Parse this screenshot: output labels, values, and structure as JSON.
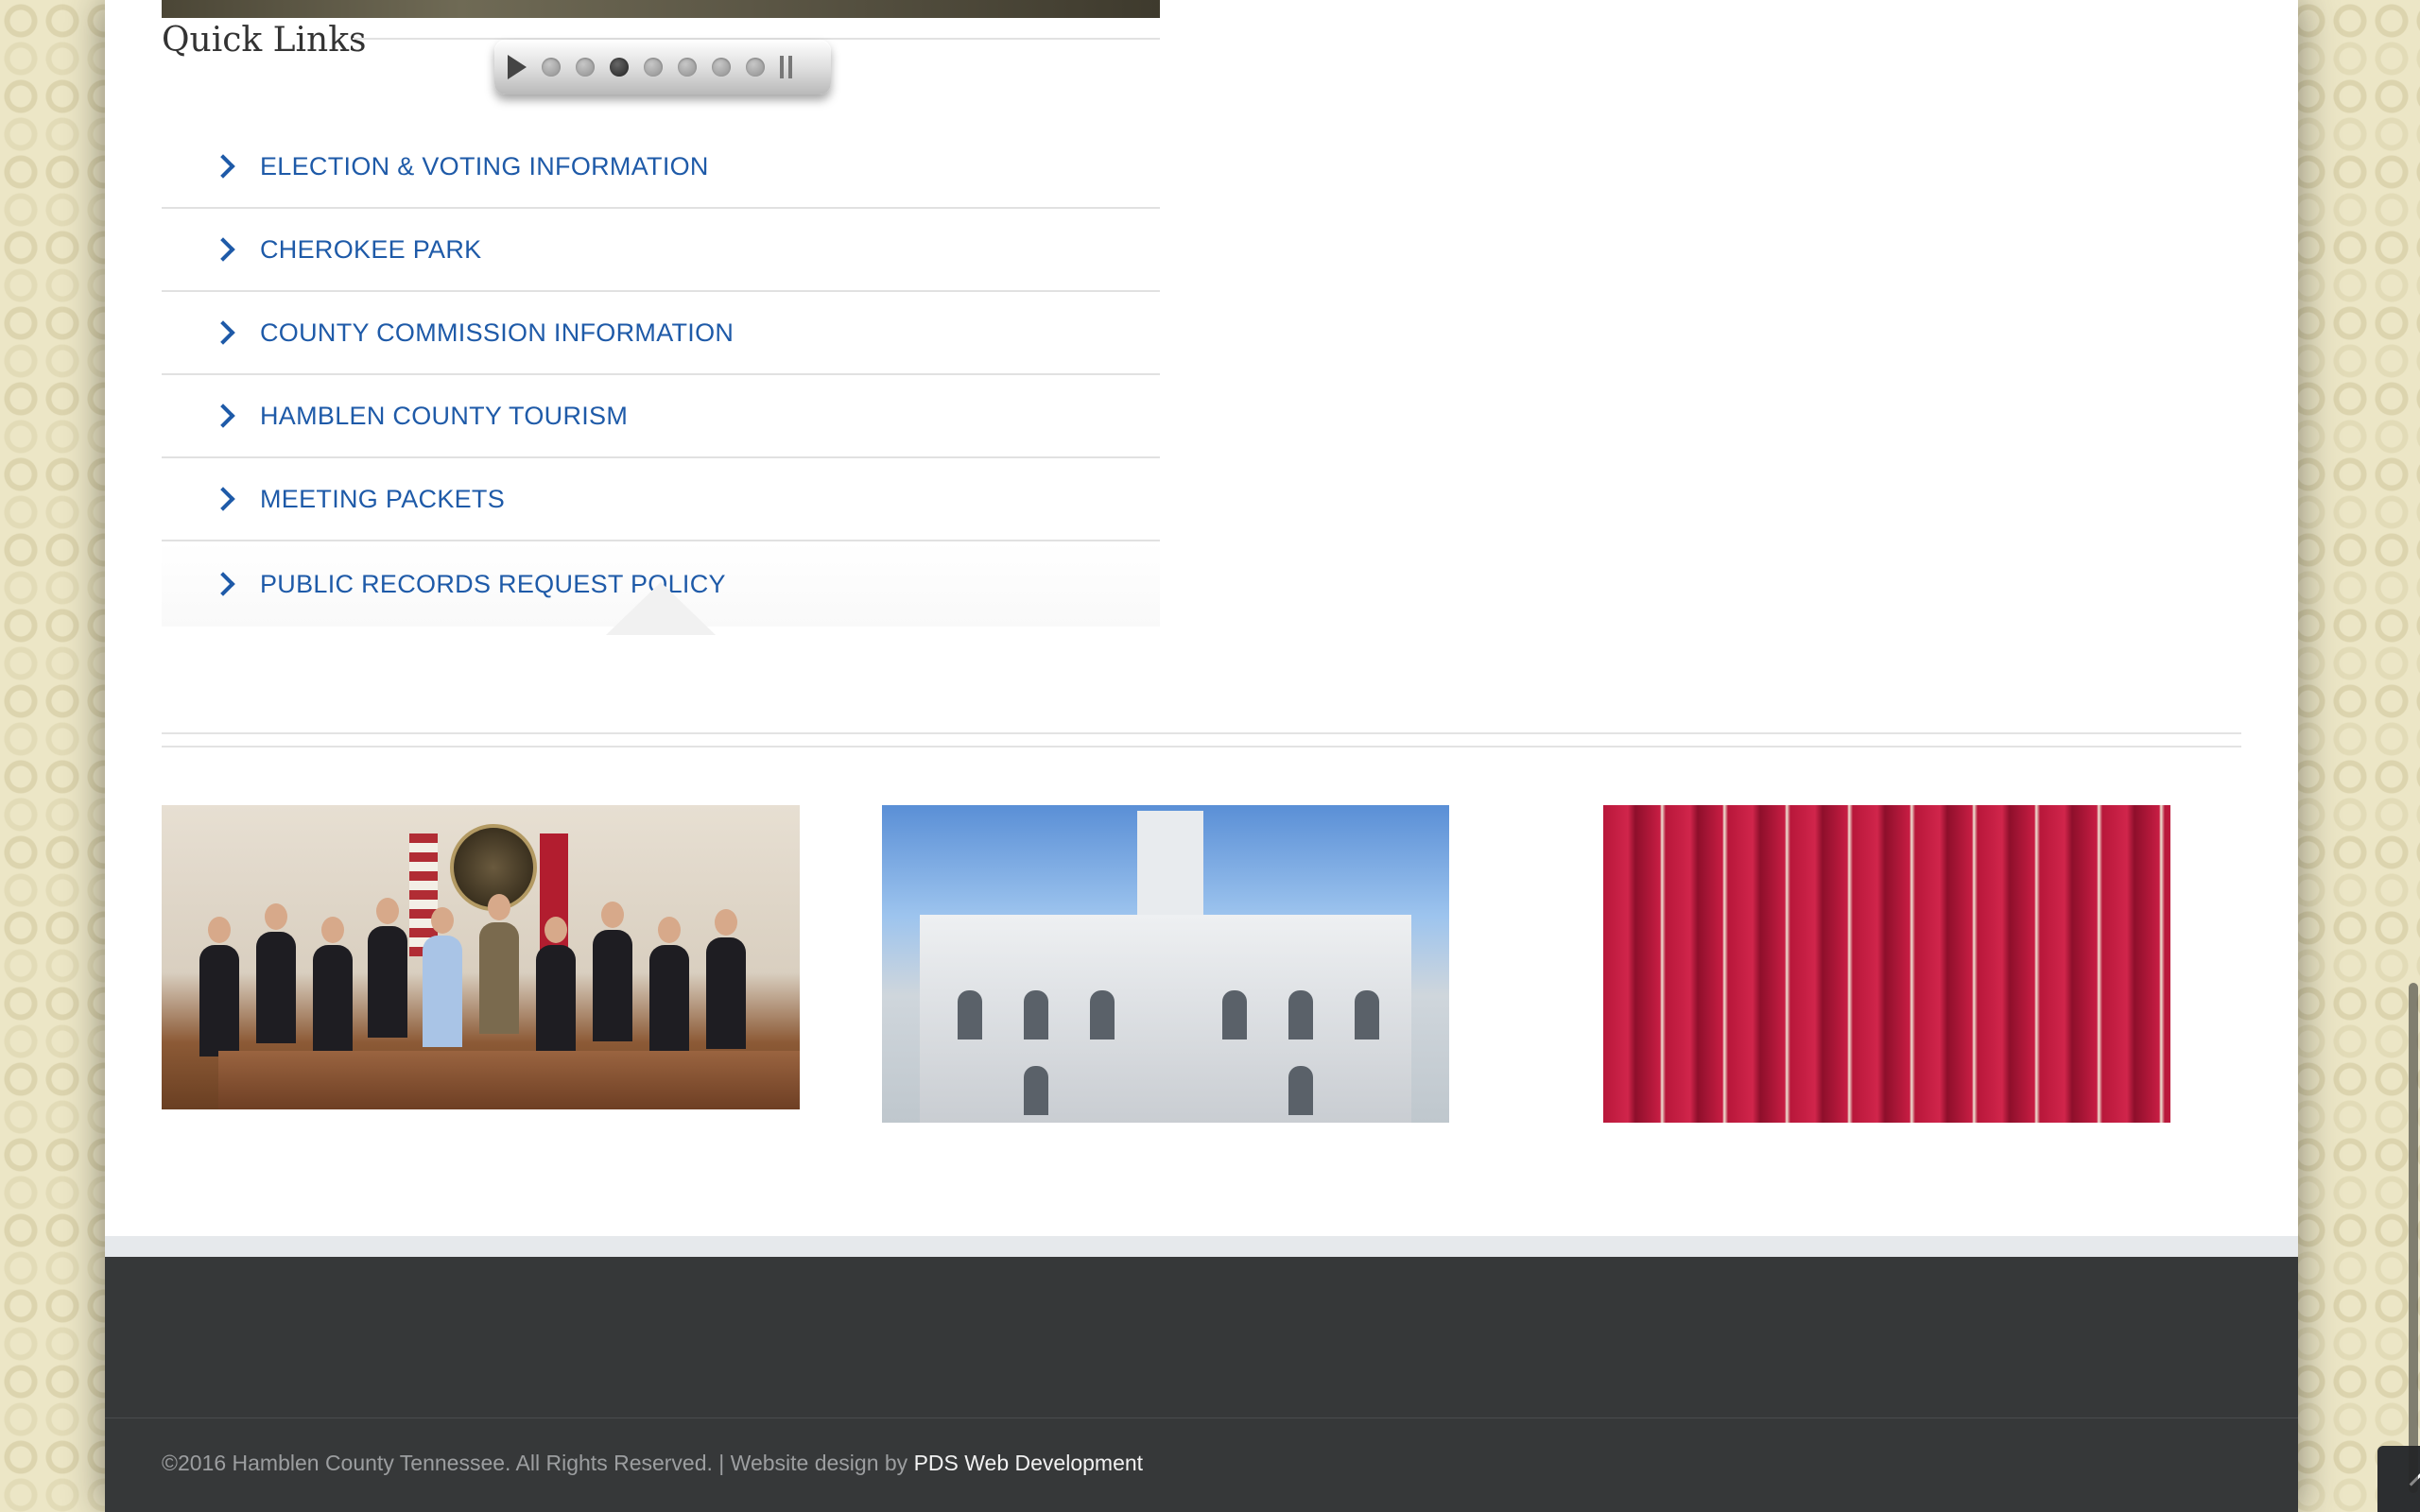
{
  "quick_links": {
    "title": "Quick Links",
    "items": [
      {
        "label": "ELECTION & VOTING INFORMATION"
      },
      {
        "label": "CHEROKEE PARK"
      },
      {
        "label": "COUNTY COMMISSION INFORMATION"
      },
      {
        "label": "HAMBLEN COUNTY TOURISM"
      },
      {
        "label": "MEETING PACKETS"
      },
      {
        "label": "PUBLIC RECORDS REQUEST POLICY"
      }
    ]
  },
  "slider": {
    "slide_count": 7,
    "active_slide": 3
  },
  "footer": {
    "copyright_text": "©2016 Hamblen County Tennessee. All Rights Reserved. | Website design by",
    "credit_link": "PDS Web Development"
  },
  "colors": {
    "link_blue": "#1e5aa8",
    "footer_bg": "#363839",
    "page_bg": "#ece6c6"
  }
}
